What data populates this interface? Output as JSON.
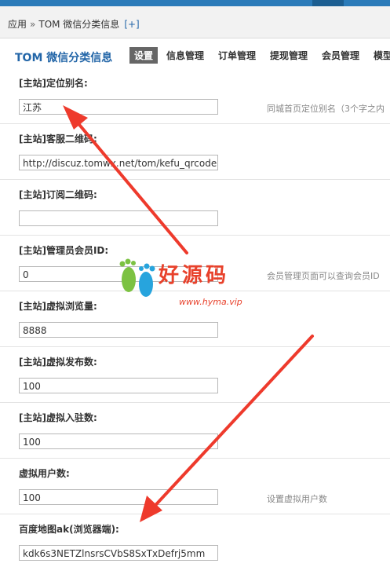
{
  "breadcrumb": {
    "app": "应用",
    "separator": "»",
    "current": "TOM 微信分类信息",
    "add": "[+]"
  },
  "nav": {
    "title": "TOM 微信分类信息",
    "tabs": [
      "设置",
      "信息管理",
      "订单管理",
      "提现管理",
      "会员管理",
      "模型"
    ]
  },
  "fields": [
    {
      "label": "[主站]定位别名:",
      "value": "江苏",
      "hint": "同城首页定位别名（3个字之内"
    },
    {
      "label": "[主站]客服二维码:",
      "value": "http://discuz.tomwx.net/tom/kefu_qrcode",
      "hint": ""
    },
    {
      "label": "[主站]订阅二维码:",
      "value": "",
      "hint": ""
    },
    {
      "label": "[主站]管理员会员ID:",
      "value": "0",
      "hint": "会员管理页面可以查询会员ID"
    },
    {
      "label": "[主站]虚拟浏览量:",
      "value": "8888",
      "hint": ""
    },
    {
      "label": "[主站]虚拟发布数:",
      "value": "100",
      "hint": ""
    },
    {
      "label": "[主站]虚拟入驻数:",
      "value": "100",
      "hint": ""
    },
    {
      "label": "虚拟用户数:",
      "value": "100",
      "hint": "设置虚拟用户数"
    },
    {
      "label": "百度地图ak(浏览器端):",
      "value": "kdk6s3NETZlnsrsCVbS8SxTxDefrj5mm",
      "hint": ""
    }
  ],
  "watermark": {
    "text": "好源码",
    "url": "www.hyma.vip"
  },
  "colors": {
    "accent": "#2366a8",
    "topbar": "#2b7bb9",
    "arrow": "#ee3a2c",
    "active_tab": "#666666"
  }
}
